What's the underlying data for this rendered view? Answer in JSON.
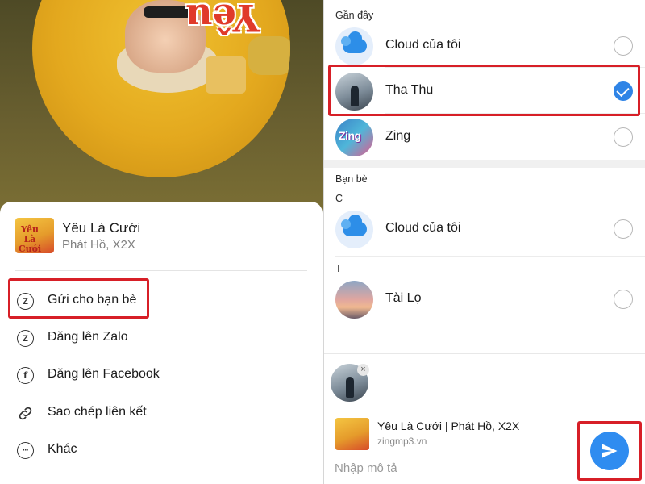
{
  "left": {
    "cover": {
      "art_text": "Yêu"
    },
    "song": {
      "title": "Yêu Là Cưới",
      "artist": "Phát Hồ, X2X",
      "thumb_text": "Yêu Là Cưới"
    },
    "menu": [
      {
        "label": "Gửi cho bạn bè",
        "icon": "zalo-send-icon"
      },
      {
        "label": "Đăng lên Zalo",
        "icon": "zalo-icon"
      },
      {
        "label": "Đăng lên Facebook",
        "icon": "facebook-icon"
      },
      {
        "label": "Sao chép liên kết",
        "icon": "link-icon"
      },
      {
        "label": "Khác",
        "icon": "more-icon"
      }
    ],
    "menu_icon_glyphs": {
      "zalo": "Z",
      "facebook": "f",
      "more": "···"
    }
  },
  "right": {
    "recent_label": "Gần đây",
    "recent": [
      {
        "name": "Cloud của tôi",
        "selected": false
      },
      {
        "name": "Tha Thu",
        "selected": true
      },
      {
        "name": "Zing",
        "selected": false
      }
    ],
    "zing_logo_text": "Zing",
    "friends_label": "Bạn bè",
    "group_c": "C",
    "friends_c": [
      {
        "name": "Cloud của tôi",
        "selected": false
      }
    ],
    "group_t": "T",
    "friends_t": [
      {
        "name": "Tài Lọ",
        "selected": false
      }
    ],
    "compose": {
      "remove_glyph": "×",
      "preview_title": "Yêu Là Cưới | Phát Hồ, X2X",
      "preview_url": "zingmp3.vn",
      "description_placeholder": "Nhập mô tả"
    }
  },
  "colors": {
    "accent_blue": "#2f8cf0",
    "highlight_red": "#d71f27"
  }
}
